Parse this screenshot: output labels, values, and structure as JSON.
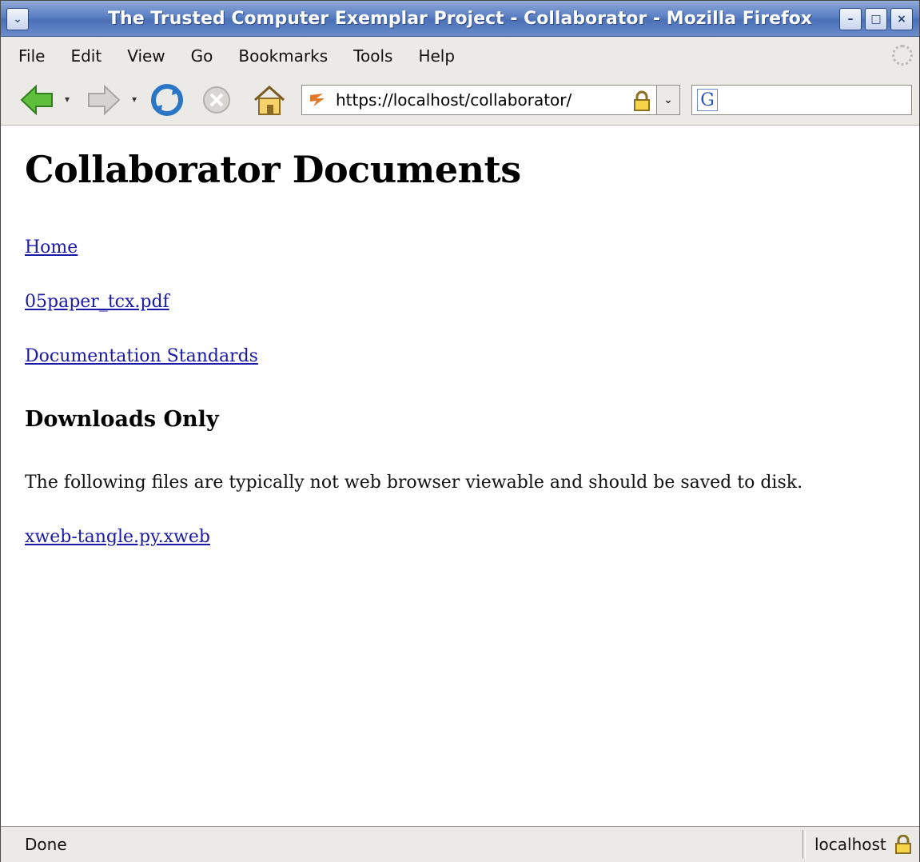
{
  "window": {
    "title": "The Trusted Computer Exemplar Project - Collaborator - Mozilla Firefox",
    "buttons": {
      "minimize": "–",
      "maximize": "□",
      "close": "×"
    }
  },
  "menu": {
    "items": [
      "File",
      "Edit",
      "View",
      "Go",
      "Bookmarks",
      "Tools",
      "Help"
    ]
  },
  "toolbar": {
    "url": "https://localhost/collaborator/",
    "search_engine": "G"
  },
  "page": {
    "heading": "Collaborator Documents",
    "links": [
      "Home",
      "05paper_tcx.pdf",
      "Documentation Standards"
    ],
    "section_heading": "Downloads Only",
    "section_text": "The following files are typically not web browser viewable and should be saved to disk.",
    "download_link": "xweb-tangle.py.xweb"
  },
  "status": {
    "text": "Done",
    "host": "localhost"
  },
  "colors": {
    "titlebar": "#5a7fc4",
    "link": "#1a1aa8",
    "chrome": "#eceae6"
  }
}
